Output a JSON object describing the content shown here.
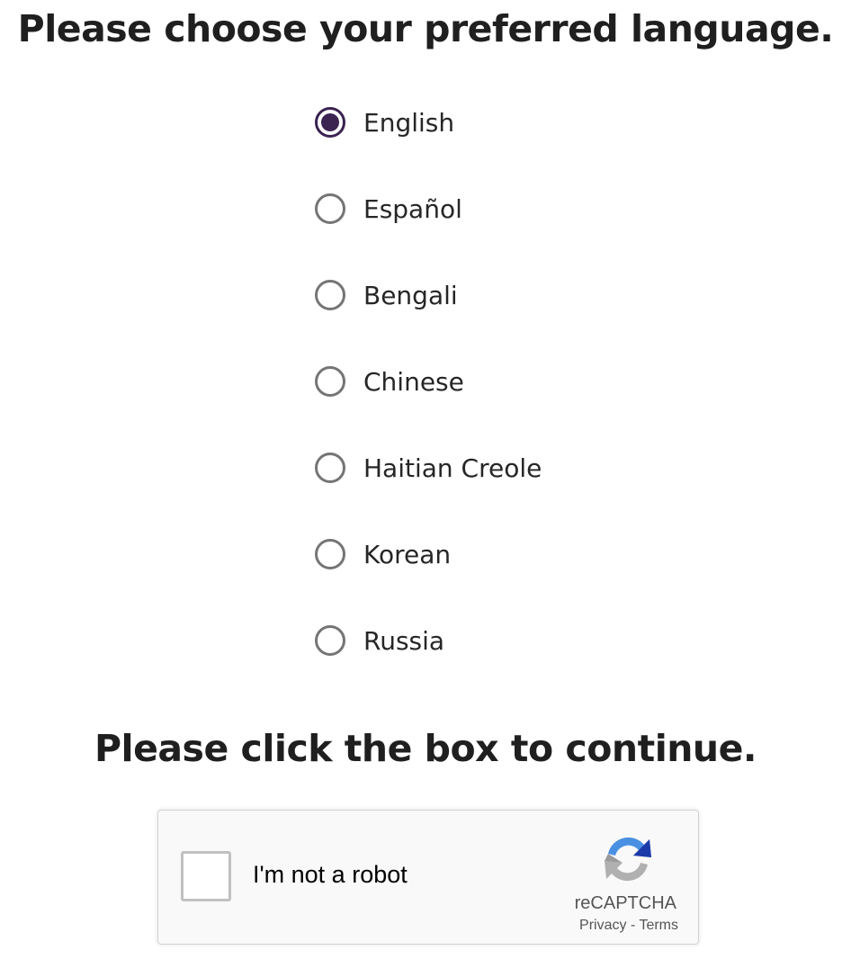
{
  "language_section": {
    "heading": "Please choose your preferred language.",
    "selected": "English",
    "options": [
      {
        "label": "English",
        "checked": true
      },
      {
        "label": "Español",
        "checked": false
      },
      {
        "label": "Bengali",
        "checked": false
      },
      {
        "label": "Chinese",
        "checked": false
      },
      {
        "label": "Haitian Creole",
        "checked": false
      },
      {
        "label": "Korean",
        "checked": false
      },
      {
        "label": "Russia",
        "checked": false
      }
    ]
  },
  "captcha_section": {
    "heading": "Please click the box to continue.",
    "checkbox_label": "I'm not a robot",
    "brand": "reCAPTCHA",
    "privacy_link": "Privacy",
    "separator": "-",
    "terms_link": "Terms"
  },
  "colors": {
    "radio_selected": "#3b2352",
    "radio_unselected": "#757575",
    "recaptcha_blue": "#4a90e2",
    "recaptcha_darkblue": "#1c3aa9",
    "recaptcha_gray": "#b0b0b0"
  },
  "icons": {
    "recaptcha_logo": "recaptcha-logo-icon"
  }
}
